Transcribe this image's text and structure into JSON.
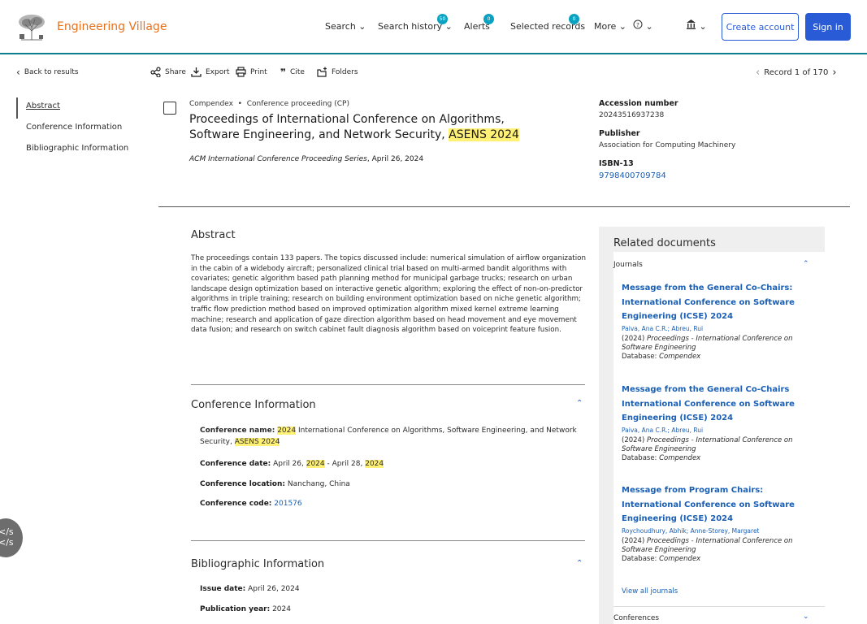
{
  "header": {
    "logo_text": "Engineering Village",
    "nav": {
      "search": "Search",
      "search_history": "Search history",
      "search_history_count": "50",
      "alerts": "Alerts",
      "alerts_count": "0",
      "selected_records": "Selected records",
      "selected_records_count": "0",
      "more": "More"
    },
    "create_account": "Create account",
    "sign_in": "Sign in"
  },
  "toolbar": {
    "back": "Back to results",
    "share": "Share",
    "export": "Export",
    "print": "Print",
    "cite": "Cite",
    "folders": "Folders",
    "record_position": "Record 1 of 170"
  },
  "left_nav": {
    "abstract": "Abstract",
    "conference_info": "Conference Information",
    "bibliographic_info": "Bibliographic Information"
  },
  "record": {
    "database": "Compendex",
    "doc_type": "Conference proceeding (CP)",
    "title_part1": "Proceedings of International Conference on Algorithms, Software Engineering, and Network Security, ",
    "title_highlight": "ASENS 2024",
    "source_series": "ACM International Conference Proceeding Series",
    "source_date": ", April 26, 2024"
  },
  "side_info": {
    "accession_label": "Accession number",
    "accession_value": "20243516937238",
    "publisher_label": "Publisher",
    "publisher_value": "Association for Computing Machinery",
    "isbn_label": "ISBN-13",
    "isbn_value": "9798400709784"
  },
  "abstract": {
    "heading": "Abstract",
    "text": "The proceedings contain 133 papers. The topics discussed include: numerical simulation of airflow organization in the cabin of a widebody aircraft; personalized clinical trial based on multi-armed bandit algorithms with covariates; genetic algorithm based path planning method for municipal garbage trucks; research on urban landscape design optimization based on interactive genetic algorithm; exploring the effect of non-on-predictor algorithms in triple training; research on building environment optimization based on niche genetic algorithm; traffic flow prediction method based on improved optimization algorithm mixed kernel extreme learning machine; research and application of gaze direction algorithm based on head movement and eye movement data fusion; and research on switch cabinet fault diagnosis algorithm based on voiceprint feature fusion."
  },
  "conference": {
    "heading": "Conference Information",
    "name_label": "Conference name:",
    "name_year": "2024",
    "name_text": " International Conference on Algorithms, Software Engineering, and Network Security, ",
    "name_highlight": "ASENS 2024",
    "date_label": "Conference date:",
    "date_start": " April 26, ",
    "date_year1": "2024",
    "date_mid": " - April 28, ",
    "date_year2": "2024",
    "location_label": "Conference location:",
    "location_value": " Nanchang, China",
    "code_label": "Conference code:",
    "code_value": "201576"
  },
  "bibliographic": {
    "heading": "Bibliographic Information",
    "issue_label": "Issue date:",
    "issue_value": " April 26, 2024",
    "year_label": "Publication year:",
    "year_value": " 2024"
  },
  "related": {
    "heading": "Related documents",
    "journals_label": "Journals",
    "conferences_label": "Conferences",
    "view_all": "View all journals",
    "items": [
      {
        "title": "Message from the General Co-Chairs: International Conference on Software Engineering (ICSE) 2024",
        "authors": "Paiva, Ana C.R.; Abreu, Rui",
        "year": "(2024) ",
        "source": "Proceedings - International Conference on Software Engineering",
        "db_label": "Database: ",
        "db": "Compendex"
      },
      {
        "title": "Message from the General Co-Chairs International Conference on Software Engineering (ICSE) 2024",
        "authors": "Paiva, Ana C.R.; Abreu, Rui",
        "year": "(2024) ",
        "source": "Proceedings - International Conference on Software Engineering",
        "db_label": "Database: ",
        "db": "Compendex"
      },
      {
        "title": "Message from Program Chairs: International Conference on Software Engineering (ICSE) 2024",
        "authors": "Roychoudhury, Abhik; Anne-Storey, Margaret",
        "year": "(2024) ",
        "source": "Proceedings - International Conference on Software Engineering",
        "db_label": "Database: ",
        "db": "Compendex"
      }
    ]
  },
  "code_widget": {
    "line1": "</s",
    "line2": "</s"
  }
}
